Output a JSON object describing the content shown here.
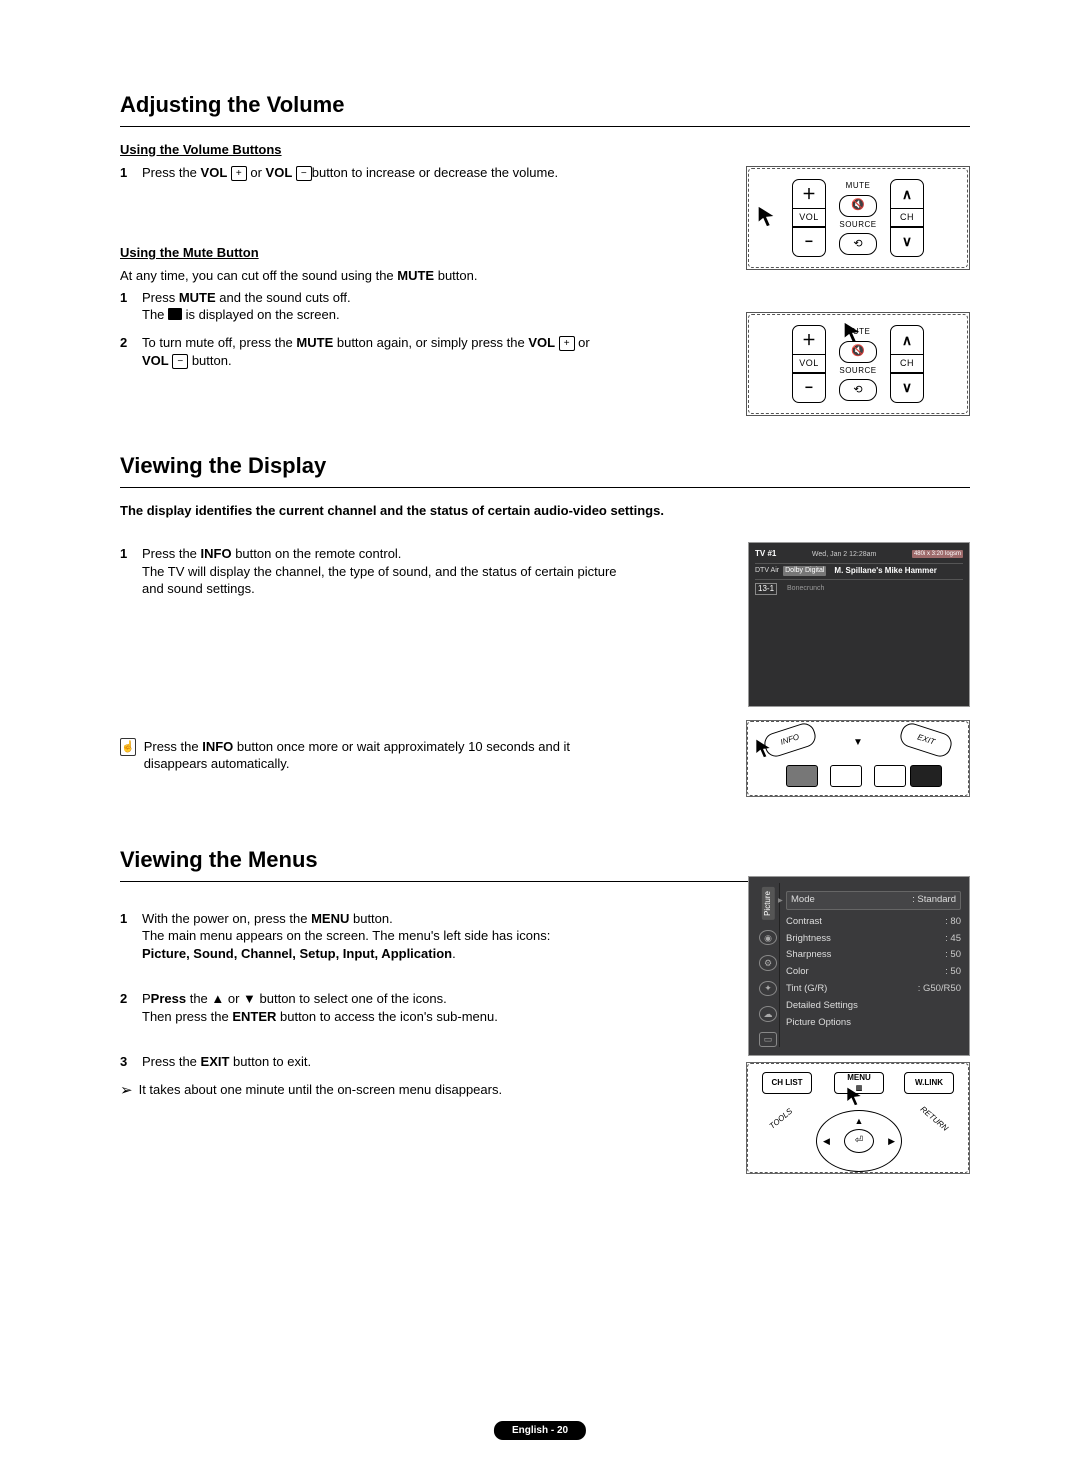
{
  "sections": {
    "volume": {
      "title": "Adjusting the Volume",
      "sub1": "Using the Volume Buttons",
      "step1_a": "Press the ",
      "step1_vol": "VOL",
      "step1_plus": "+",
      "step1_b": " or ",
      "step1_minus": "−",
      "step1_c": "button to increase or decrease the volume.",
      "sub2": "Using the Mute Button",
      "intro2": "At any time, you can cut off the sound using the ",
      "intro2_mute": "MUTE",
      "intro2_b": " button.",
      "m1_a": "Press ",
      "m1_mute": "MUTE",
      "m1_b": " and the sound cuts off.",
      "m1_c": "The ",
      "m1_d": " is displayed on the screen.",
      "m2_a": "To turn mute off, press the ",
      "m2_mute": "MUTE",
      "m2_b": " button again, or simply press the ",
      "m2_vol": "VOL",
      "m2_plus": "+",
      "m2_or": " or ",
      "m2_vol2": "VOL",
      "m2_minus": "−",
      "m2_c": " button."
    },
    "display": {
      "title": "Viewing the Display",
      "intro": "The display identifies the current channel and the status of certain audio-video settings.",
      "s1_a": "Press the ",
      "s1_info": "INFO",
      "s1_b": " button on the remote control.",
      "s1_c": "The TV will display the channel, the type of sound, and the status of certain picture and sound settings.",
      "note_a": "Press the ",
      "note_info": "INFO",
      "note_b": " button once more or wait approximately 10 seconds and it disappears automatically."
    },
    "menus": {
      "title": "Viewing the Menus",
      "s1_a": "With the power on, press the ",
      "s1_menu": "MENU",
      "s1_b": " button.",
      "s1_c": "The main menu appears on the screen. The menu's left side has icons:",
      "s1_d": "Picture, Sound, Channel, Setup, Input, Application",
      "s1_e": ".",
      "s2_a": "Press",
      "s2_b": " the ▲ or ▼ button to select one of the icons.",
      "s2_c": "Then press the ",
      "s2_enter": "ENTER",
      "s2_d": " button to access the icon's sub-menu.",
      "s3_a": "Press the ",
      "s3_exit": "EXIT",
      "s3_b": " button to exit.",
      "tip_arrow": "➢",
      "tip": "It takes about one minute until the on-screen menu disappears."
    }
  },
  "remote": {
    "vol_label": "VOL",
    "ch_label": "CH",
    "mute_label": "MUTE",
    "source_label": "SOURCE",
    "plus": "＋",
    "minus": "−",
    "up": "∧",
    "down": "∨",
    "mute_glyph": "🔇",
    "source_glyph": "⟲"
  },
  "tv": {
    "header": "TV #1",
    "date": "Wed, Jan 2  12:28am",
    "right_chip": "480i x 3:20 logsm",
    "band": "DTV Air",
    "dd": "Dolby Digital",
    "show": "M. Spillane's Mike Hammer",
    "ch": "13-1",
    "bottom": "Bonecrunch"
  },
  "dpad_labels": {
    "info": "INFO",
    "exit": "EXIT"
  },
  "pmenu": {
    "side_label": "Picture",
    "rows": [
      {
        "k": "Mode",
        "v": ": Standard"
      },
      {
        "k": "Contrast",
        "v": ": 80"
      },
      {
        "k": "Brightness",
        "v": ": 45"
      },
      {
        "k": "Sharpness",
        "v": ": 50"
      },
      {
        "k": "Color",
        "v": ": 50"
      },
      {
        "k": "Tint (G/R)",
        "v": ": G50/R50"
      },
      {
        "k": "Detailed Settings",
        "v": ""
      },
      {
        "k": "Picture Options",
        "v": ""
      }
    ]
  },
  "nav": {
    "chlist": "CH LIST",
    "menu": "MENU",
    "wlink": "W.LINK",
    "tools": "TOOLS",
    "return": "RETURN",
    "enter": "⏎"
  },
  "footer": "English - 20"
}
